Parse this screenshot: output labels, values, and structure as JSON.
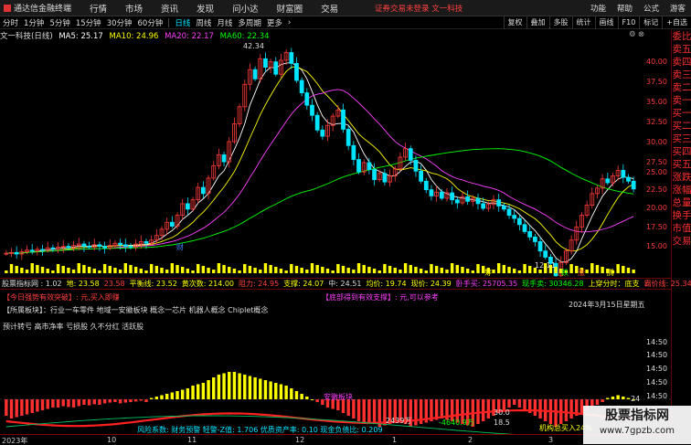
{
  "menubar": {
    "app_name": "通达信金融终端",
    "menus": [
      "行情",
      "市场",
      "资讯",
      "发现",
      "问小达",
      "财富圈",
      "交易"
    ],
    "notice": "证券交易未登录  文一科技",
    "right": [
      "功能",
      "帮助",
      "公式",
      "游客"
    ]
  },
  "toolbar": {
    "periods": [
      "分时",
      "1分钟",
      "5分钟",
      "15分钟",
      "30分钟",
      "60分钟",
      "日线",
      "周线",
      "月线",
      "多周期",
      "更多"
    ],
    "active": "日线",
    "right_buttons": [
      "复权",
      "叠加",
      "多股",
      "统计",
      "画线",
      "F10",
      "标记",
      "+自选"
    ]
  },
  "ma": {
    "title": "文一科技(日线)",
    "ma5": "MA5: 25.17",
    "ma10": "MA10: 24.96",
    "ma20": "MA20: 22.17",
    "ma60": "MA60: 22.34"
  },
  "right_strip": [
    "委比",
    "卖五",
    "卖四",
    "卖三",
    "卖二",
    "卖一",
    "买一",
    "买二",
    "买三",
    "买四",
    "买五",
    "涨跌",
    "涨幅",
    "总量",
    "换手",
    "市值",
    "交易"
  ],
  "price_axis": {
    "main": [
      "40.00",
      "37.50",
      "35.00",
      "32.50",
      "30.00",
      "27.50",
      "25.00",
      "22.50",
      "20.00",
      "17.50",
      "15.00"
    ],
    "sub": [
      "14:50",
      "14:50",
      "14:50",
      "14:50",
      "14:50",
      "14:50"
    ]
  },
  "annotations": {
    "high": "42.34",
    "low": "12.11",
    "cai": "财",
    "chou": "筹",
    "die": "跌",
    "zhang": "涨",
    "teng": "腾"
  },
  "infoline": {
    "indicator": "股票指标网 : 1.02",
    "di": "地: 23.58",
    "v2": "23.58",
    "pinghen": "平衡线: 23.52",
    "huangci": "黄次数: 214.00",
    "zuli": "阻力: 24.95",
    "zhicheng": "支撑: 24.07",
    "zhong": "中: 24.51",
    "junjia": "均价: 19.74",
    "xianjia": "现价: 24.39",
    "v3": "卧手买: 25705.35",
    "xianshou": "现手卖: 30346.28",
    "shangsheng": "上穿分时：底支",
    "ba": "霸价线: 25.34"
  },
  "sub1": {
    "tag1": "【今日强势有效突破】: 元,买入即赚",
    "tag2": "【底部得到有效支撑】: 元,可以参考",
    "date": "2024年3月15日星期五",
    "concept": "【所属板块】：行业一车零件 地域一安徽板块 概念一芯片 机器人概念 Chiplet概念",
    "finance": "预计转亏  高市净率  亏损股  久不分红  活跃股"
  },
  "sub2": {
    "label": "安徽板块",
    "bottom_text": "风险系数: 财务预警 轻警-Z值: 1.706 优质资产率: 0.10 现金负债比: 0.209",
    "v1": "2439万",
    "v2": "-4640.9万",
    "v3": "机构总买入24%",
    "right_label": "24",
    "extra1": "30.0",
    "extra2": "18.5"
  },
  "bottom_axis": [
    "2023年",
    "10",
    "11",
    "12",
    "1",
    "2",
    "3"
  ],
  "watermark": {
    "big": "股票指标网",
    "small": "www.7gpzb.com"
  },
  "chart_data": {
    "type": "candlestick",
    "title": "文一科技(日线)",
    "ylim": [
      14,
      43
    ],
    "ma": {
      "MA5": 25.17,
      "MA10": 24.96,
      "MA20": 22.17,
      "MA60": 22.34
    },
    "high_marker": 42.34,
    "low_marker": 12.11,
    "closes": [
      16.1,
      16.2,
      16.0,
      16.3,
      16.5,
      16.4,
      16.6,
      16.5,
      16.8,
      16.7,
      16.9,
      17.0,
      16.8,
      17.1,
      17.3,
      17.0,
      16.9,
      17.2,
      17.0,
      16.8,
      17.1,
      17.4,
      17.2,
      17.0,
      16.9,
      17.3,
      17.6,
      17.4,
      17.8,
      18.4,
      19.2,
      20.1,
      19.6,
      21.0,
      22.5,
      21.8,
      23.0,
      24.6,
      23.8,
      25.8,
      27.4,
      28.8,
      27.9,
      30.5,
      32.8,
      35.0,
      37.9,
      39.8,
      38.6,
      41.2,
      40.1,
      40.8,
      39.2,
      41.0,
      42.0,
      40.6,
      38.4,
      36.8,
      35.2,
      33.9,
      32.0,
      31.2,
      32.6,
      33.8,
      34.6,
      32.1,
      30.0,
      28.2,
      26.6,
      27.8,
      26.9,
      25.6,
      26.4,
      25.3,
      26.1,
      27.0,
      28.5,
      29.6,
      28.1,
      26.7,
      25.4,
      24.3,
      23.5,
      24.0,
      23.2,
      23.9,
      23.0,
      22.6,
      23.4,
      22.8,
      23.2,
      22.5,
      21.9,
      22.4,
      23.0,
      22.2,
      21.8,
      21.0,
      20.6,
      19.8,
      18.9,
      18.2,
      17.6,
      16.4,
      15.6,
      14.8,
      13.2,
      14.9,
      16.4,
      17.8,
      19.5,
      21.0,
      22.3,
      23.8,
      24.5,
      25.7,
      25.2,
      26.1,
      26.8,
      25.9,
      25.4,
      24.4
    ],
    "macd": [
      -0.6,
      -0.7,
      -0.65,
      -0.6,
      -0.55,
      -0.5,
      -0.45,
      -0.4,
      -0.35,
      -0.3,
      -0.3,
      -0.25,
      -0.28,
      -0.3,
      -0.25,
      -0.2,
      -0.22,
      -0.18,
      -0.2,
      -0.15,
      -0.12,
      -0.1,
      -0.15,
      -0.12,
      -0.1,
      -0.08,
      -0.05,
      -0.1,
      0.05,
      0.1,
      0.15,
      0.2,
      0.25,
      0.3,
      0.35,
      0.4,
      0.5,
      0.55,
      0.6,
      0.7,
      0.8,
      0.9,
      0.95,
      1.0,
      1.0,
      0.95,
      0.9,
      0.85,
      0.8,
      0.75,
      0.7,
      0.65,
      0.6,
      0.55,
      0.5,
      0.4,
      0.3,
      0.2,
      0.1,
      0.0,
      -0.1,
      -0.2,
      -0.3,
      -0.35,
      -0.4,
      -0.5,
      -0.6,
      -0.7,
      -0.8,
      -0.9,
      -0.85,
      -0.9,
      -1.0,
      -0.95,
      -0.9,
      -0.85,
      -0.8,
      -0.9,
      -1.0,
      -0.95,
      -0.9,
      -0.85,
      -0.8,
      -0.75,
      -0.7,
      -0.75,
      -0.8,
      -0.85,
      -0.9,
      -0.95,
      -1.0,
      -0.9,
      -0.8,
      -0.7,
      -0.6,
      -0.5,
      -0.4,
      -0.3,
      -0.2,
      -0.3,
      -0.4,
      -0.5,
      -0.6,
      -0.7,
      -0.8,
      -0.9,
      -1.0,
      -0.9,
      -0.8,
      -0.7,
      -0.6,
      -0.5,
      -0.4,
      -0.3,
      -0.2,
      -0.1,
      0.05,
      0.1,
      0.15,
      0.1,
      0.05,
      0.0
    ]
  }
}
